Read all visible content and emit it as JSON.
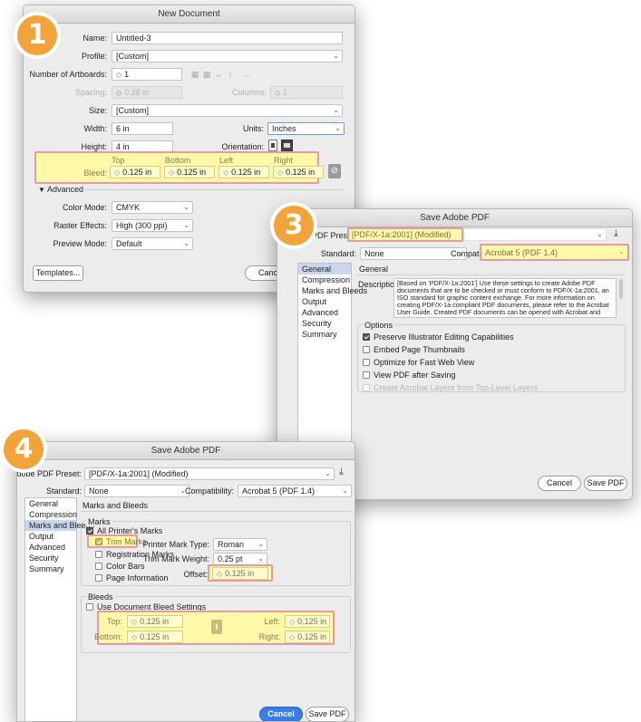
{
  "badges": [
    "1",
    "3",
    "4"
  ],
  "new_doc": {
    "title": "New Document",
    "name_label": "Name:",
    "name_value": "Untitled-3",
    "profile_label": "Profile:",
    "profile_value": "[Custom]",
    "artboards_label": "Number of Artboards:",
    "artboards_value": "1",
    "spacing_label": "Spacing:",
    "spacing_value": "0.28 in",
    "columns_label": "Columns:",
    "columns_value": "1",
    "size_label": "Size:",
    "size_value": "[Custom]",
    "width_label": "Width:",
    "width_value": "6 in",
    "units_label": "Units:",
    "units_value": "Inches",
    "height_label": "Height:",
    "height_value": "4 in",
    "orientation_label": "Orientation:",
    "bleed_label": "Bleed:",
    "bleed_headers": [
      "Top",
      "Bottom",
      "Left",
      "Right"
    ],
    "bleed_values": [
      "0.125 in",
      "0.125 in",
      "0.125 in",
      "0.125 in"
    ],
    "advanced_label": "Advanced",
    "color_mode_label": "Color Mode:",
    "color_mode_value": "CMYK",
    "raster_label": "Raster Effects:",
    "raster_value": "High (300 ppi)",
    "preview_label": "Preview Mode:",
    "preview_value": "Default",
    "templates_button": "Templates...",
    "cancel_button": "Cancel"
  },
  "pdf3": {
    "title": "Save Adobe PDF",
    "preset_label": "Adobe PDF Preset:",
    "preset_value": "[PDF/X-1a:2001] (Modified)",
    "standard_label": "Standard:",
    "standard_value": "None",
    "compat_label": "Compatibility:",
    "compat_value": "Acrobat 5 (PDF 1.4)",
    "sidebar": [
      "General",
      "Compression",
      "Marks and Bleeds",
      "Output",
      "Advanced",
      "Security",
      "Summary"
    ],
    "section_title": "General",
    "description_label": "Description:",
    "description_text": "[Based on 'PDF/X-1a:2001'] Use these settings to create Adobe PDF documents that are to be checked or must conform to PDF/X-1a:2001, an ISO standard for graphic content exchange. For more information on creating PDF/X-1a compliant PDF documents, please refer to the Acrobat User Guide. Created PDF documents can be opened with Acrobat and Adobe",
    "options_label": "Options",
    "options": [
      {
        "label": "Preserve Illustrator Editing Capabilities",
        "checked": true
      },
      {
        "label": "Embed Page Thumbnails",
        "checked": false
      },
      {
        "label": "Optimize for Fast Web View",
        "checked": false
      },
      {
        "label": "View PDF after Saving",
        "checked": false
      },
      {
        "label": "Create Acrobat Layers from Top-Level Layers",
        "checked": false
      }
    ],
    "cancel_button": "Cancel",
    "save_button": "Save PDF"
  },
  "pdf4": {
    "title": "Save Adobe PDF",
    "preset_label": "Adobe PDF Preset:",
    "preset_value": "[PDF/X-1a:2001] (Modified)",
    "standard_label": "Standard:",
    "standard_value": "None",
    "compat_label": "Compatibility:",
    "compat_value": "Acrobat 5 (PDF 1.4)",
    "sidebar": [
      "General",
      "Compression",
      "Marks and Bleeds",
      "Output",
      "Advanced",
      "Security",
      "Summary"
    ],
    "section_title": "Marks and Bleeds",
    "marks_label": "Marks",
    "all_marks": "All Printer's Marks",
    "trim_marks": "Trim Marks",
    "registration_marks": "Registration Marks",
    "color_bars": "Color Bars",
    "page_info": "Page Information",
    "mark_type_label": "Printer Mark Type:",
    "mark_type_value": "Roman",
    "mark_weight_label": "Trim Mark Weight:",
    "mark_weight_value": "0.25 pt",
    "offset_label": "Offset:",
    "offset_value": "0.125 in",
    "bleeds_label": "Bleeds",
    "use_doc_bleed": "Use Document Bleed Settings",
    "top_label": "Top:",
    "top_value": "0.125 in",
    "bottom_label": "Bottom:",
    "bottom_value": "0.125 in",
    "left_label": "Left:",
    "left_value": "0.125 in",
    "right_label": "Right:",
    "right_value": "0.125 in",
    "cancel_button": "Cancel",
    "save_button": "Save PDF"
  }
}
